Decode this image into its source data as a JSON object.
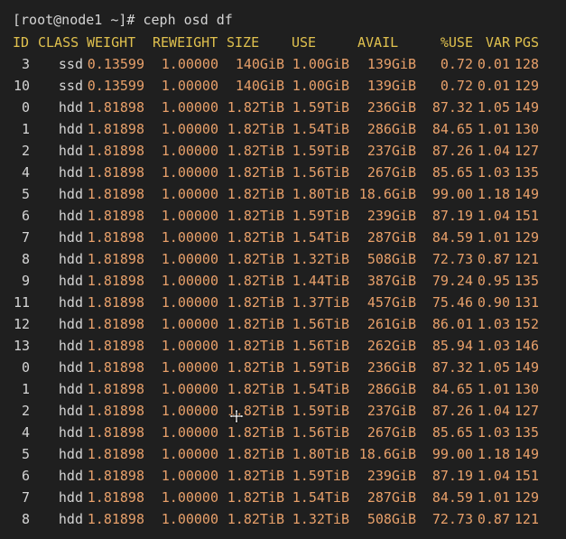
{
  "terminal": {
    "prompt": "[root@node1 ~]# ceph osd df",
    "headers": {
      "id": "ID",
      "class": "CLASS",
      "weight": "WEIGHT",
      "reweight": "REWEIGHT",
      "size": "SIZE",
      "use": "USE",
      "avail": "AVAIL",
      "pct": "%USE",
      "var": "VAR",
      "pgs": "PGS"
    },
    "rows": [
      {
        "id": "3",
        "class": "ssd",
        "weight": "0.13599",
        "reweight": "1.00000",
        "size": "140GiB",
        "use": "1.00GiB",
        "avail": "139GiB",
        "pct": "0.72",
        "var": "0.01",
        "pgs": "128"
      },
      {
        "id": "10",
        "class": "ssd",
        "weight": "0.13599",
        "reweight": "1.00000",
        "size": "140GiB",
        "use": "1.00GiB",
        "avail": "139GiB",
        "pct": "0.72",
        "var": "0.01",
        "pgs": "129"
      },
      {
        "id": "0",
        "class": "hdd",
        "weight": "1.81898",
        "reweight": "1.00000",
        "size": "1.82TiB",
        "use": "1.59TiB",
        "avail": "236GiB",
        "pct": "87.32",
        "var": "1.05",
        "pgs": "149"
      },
      {
        "id": "1",
        "class": "hdd",
        "weight": "1.81898",
        "reweight": "1.00000",
        "size": "1.82TiB",
        "use": "1.54TiB",
        "avail": "286GiB",
        "pct": "84.65",
        "var": "1.01",
        "pgs": "130"
      },
      {
        "id": "2",
        "class": "hdd",
        "weight": "1.81898",
        "reweight": "1.00000",
        "size": "1.82TiB",
        "use": "1.59TiB",
        "avail": "237GiB",
        "pct": "87.26",
        "var": "1.04",
        "pgs": "127"
      },
      {
        "id": "4",
        "class": "hdd",
        "weight": "1.81898",
        "reweight": "1.00000",
        "size": "1.82TiB",
        "use": "1.56TiB",
        "avail": "267GiB",
        "pct": "85.65",
        "var": "1.03",
        "pgs": "135"
      },
      {
        "id": "5",
        "class": "hdd",
        "weight": "1.81898",
        "reweight": "1.00000",
        "size": "1.82TiB",
        "use": "1.80TiB",
        "avail": "18.6GiB",
        "pct": "99.00",
        "var": "1.18",
        "pgs": "149"
      },
      {
        "id": "6",
        "class": "hdd",
        "weight": "1.81898",
        "reweight": "1.00000",
        "size": "1.82TiB",
        "use": "1.59TiB",
        "avail": "239GiB",
        "pct": "87.19",
        "var": "1.04",
        "pgs": "151"
      },
      {
        "id": "7",
        "class": "hdd",
        "weight": "1.81898",
        "reweight": "1.00000",
        "size": "1.82TiB",
        "use": "1.54TiB",
        "avail": "287GiB",
        "pct": "84.59",
        "var": "1.01",
        "pgs": "129"
      },
      {
        "id": "8",
        "class": "hdd",
        "weight": "1.81898",
        "reweight": "1.00000",
        "size": "1.82TiB",
        "use": "1.32TiB",
        "avail": "508GiB",
        "pct": "72.73",
        "var": "0.87",
        "pgs": "121"
      },
      {
        "id": "9",
        "class": "hdd",
        "weight": "1.81898",
        "reweight": "1.00000",
        "size": "1.82TiB",
        "use": "1.44TiB",
        "avail": "387GiB",
        "pct": "79.24",
        "var": "0.95",
        "pgs": "135"
      },
      {
        "id": "11",
        "class": "hdd",
        "weight": "1.81898",
        "reweight": "1.00000",
        "size": "1.82TiB",
        "use": "1.37TiB",
        "avail": "457GiB",
        "pct": "75.46",
        "var": "0.90",
        "pgs": "131"
      },
      {
        "id": "12",
        "class": "hdd",
        "weight": "1.81898",
        "reweight": "1.00000",
        "size": "1.82TiB",
        "use": "1.56TiB",
        "avail": "261GiB",
        "pct": "86.01",
        "var": "1.03",
        "pgs": "152"
      },
      {
        "id": "13",
        "class": "hdd",
        "weight": "1.81898",
        "reweight": "1.00000",
        "size": "1.82TiB",
        "use": "1.56TiB",
        "avail": "262GiB",
        "pct": "85.94",
        "var": "1.03",
        "pgs": "146"
      },
      {
        "id": "0",
        "class": "hdd",
        "weight": "1.81898",
        "reweight": "1.00000",
        "size": "1.82TiB",
        "use": "1.59TiB",
        "avail": "236GiB",
        "pct": "87.32",
        "var": "1.05",
        "pgs": "149"
      },
      {
        "id": "1",
        "class": "hdd",
        "weight": "1.81898",
        "reweight": "1.00000",
        "size": "1.82TiB",
        "use": "1.54TiB",
        "avail": "286GiB",
        "pct": "84.65",
        "var": "1.01",
        "pgs": "130"
      },
      {
        "id": "2",
        "class": "hdd",
        "weight": "1.81898",
        "reweight": "1.00000",
        "size": "1.82TiB",
        "use": "1.59TiB",
        "avail": "237GiB",
        "pct": "87.26",
        "var": "1.04",
        "pgs": "127"
      },
      {
        "id": "4",
        "class": "hdd",
        "weight": "1.81898",
        "reweight": "1.00000",
        "size": "1.82TiB",
        "use": "1.56TiB",
        "avail": "267GiB",
        "pct": "85.65",
        "var": "1.03",
        "pgs": "135"
      },
      {
        "id": "5",
        "class": "hdd",
        "weight": "1.81898",
        "reweight": "1.00000",
        "size": "1.82TiB",
        "use": "1.80TiB",
        "avail": "18.6GiB",
        "pct": "99.00",
        "var": "1.18",
        "pgs": "149"
      },
      {
        "id": "6",
        "class": "hdd",
        "weight": "1.81898",
        "reweight": "1.00000",
        "size": "1.82TiB",
        "use": "1.59TiB",
        "avail": "239GiB",
        "pct": "87.19",
        "var": "1.04",
        "pgs": "151"
      },
      {
        "id": "7",
        "class": "hdd",
        "weight": "1.81898",
        "reweight": "1.00000",
        "size": "1.82TiB",
        "use": "1.54TiB",
        "avail": "287GiB",
        "pct": "84.59",
        "var": "1.01",
        "pgs": "129"
      },
      {
        "id": "8",
        "class": "hdd",
        "weight": "1.81898",
        "reweight": "1.00000",
        "size": "1.82TiB",
        "use": "1.32TiB",
        "avail": "508GiB",
        "pct": "72.73",
        "var": "0.87",
        "pgs": "121"
      }
    ],
    "cursor_icon": "move-cursor-icon"
  },
  "colors": {
    "background": "#1f1f1f",
    "prompt_text": "#d4d4d4",
    "header_text": "#e0c14e",
    "value_text": "#e8a06a",
    "id_class_text": "#d4d4d4"
  }
}
